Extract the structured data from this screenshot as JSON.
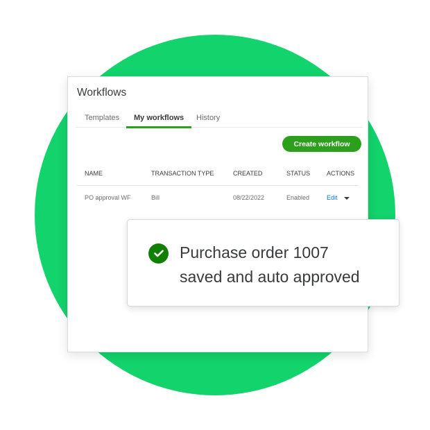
{
  "colors": {
    "background_circle": "#13d36c",
    "accent_green": "#2ca01c",
    "success_icon": "#108000",
    "link_blue": "#0077c5"
  },
  "header": {
    "title": "Workflows"
  },
  "tabs": [
    {
      "label": "Templates",
      "active": false
    },
    {
      "label": "My workflows",
      "active": true
    },
    {
      "label": "History",
      "active": false
    }
  ],
  "toolbar": {
    "create_label": "Create workflow"
  },
  "table": {
    "columns": [
      "NAME",
      "TRANSACTION TYPE",
      "CREATED",
      "STATUS",
      "ACTIONS"
    ],
    "rows": [
      {
        "name": "PO approval WF",
        "transaction_type": "Bill",
        "created": "08/22/2022",
        "status": "Enabled",
        "action": "Edit",
        "action_icon": "caret-down-icon"
      }
    ]
  },
  "toast": {
    "icon": "check-circle-icon",
    "line1": "Purchase order 1007",
    "line2": "saved and auto approved"
  }
}
